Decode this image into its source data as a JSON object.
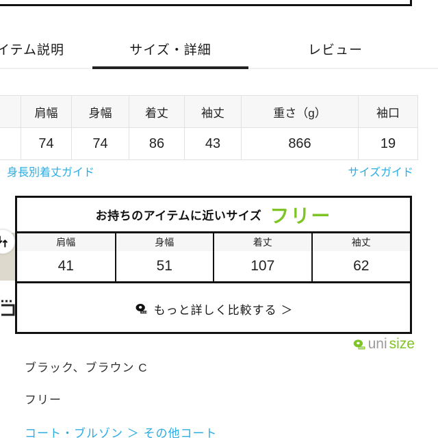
{
  "tabs": [
    {
      "label": "アイテム説明",
      "active": false
    },
    {
      "label": "サイズ・詳細",
      "active": true
    },
    {
      "label": "レビュー",
      "active": false
    }
  ],
  "spec_table": {
    "headers": [
      "",
      "肩幅",
      "身幅",
      "着丈",
      "袖丈",
      "重さ（g）",
      "袖口"
    ],
    "rows": [
      [
        "",
        "74",
        "74",
        "86",
        "43",
        "866",
        "19"
      ]
    ]
  },
  "guides": {
    "left_link": "：身長別着丈ガイド",
    "right_link": "サイズガイド"
  },
  "unisize": {
    "head_label": "お持ちのアイテムに近いサイズ",
    "head_size": "フリー",
    "table": {
      "headers": [
        "肩幅",
        "身幅",
        "着丈",
        "袖丈"
      ],
      "values": [
        "41",
        "51",
        "107",
        "62"
      ]
    },
    "more_label": "もっと詳しく比較する ＞",
    "more_icon": "tape-measure-icon",
    "swap_icon": "swap-arrows-icon",
    "logo": {
      "mark": "tape-measure-icon",
      "uni": "uni",
      "size": "size"
    }
  },
  "product_info": {
    "colors": "ブラック、ブラウン C",
    "size": "フリー",
    "breadcrumb": "コート・ブルゾン ＞ その他コート"
  },
  "colors": {
    "link_blue": "#2bace2",
    "brand_green": "#7ec424",
    "border_black": "#111111",
    "header_bg": "#f7f7f7"
  }
}
